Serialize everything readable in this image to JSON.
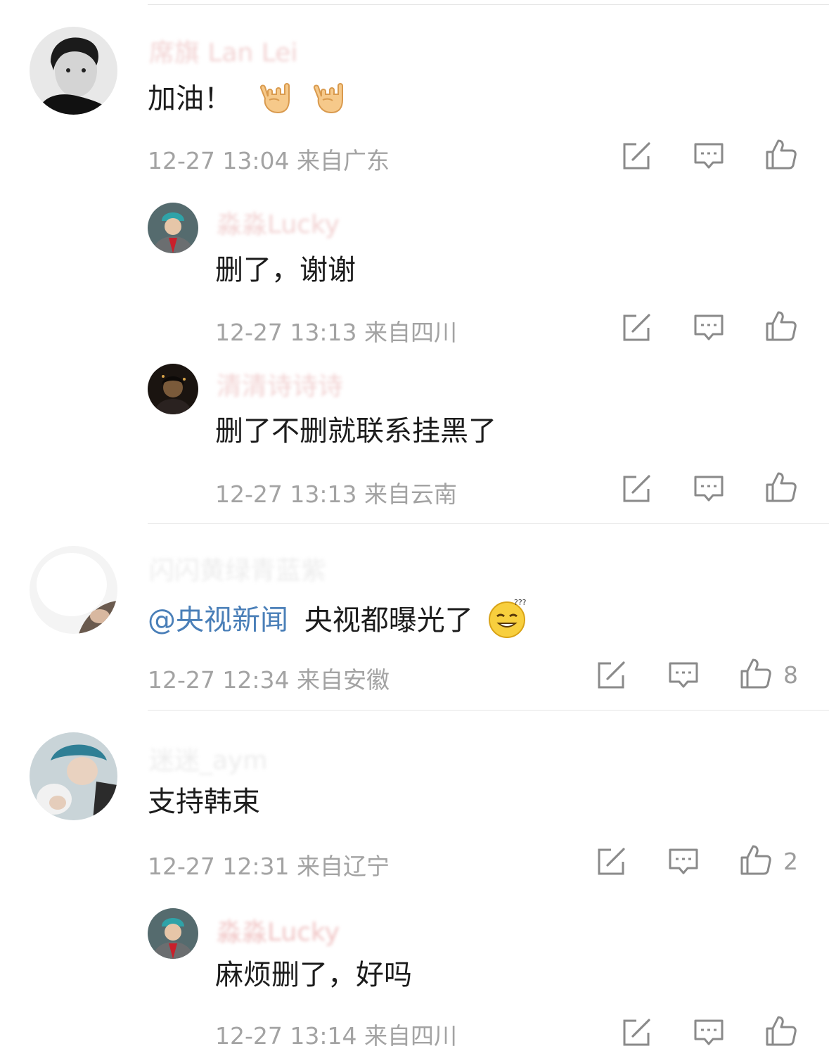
{
  "comments": [
    {
      "name": "席旗 Lan Lei",
      "text": "加油！",
      "meta": "12-27 13:04 来自广东",
      "replies": [
        {
          "name": "淼淼Lucky",
          "text": "删了，谢谢",
          "meta": "12-27 13:13 来自四川"
        },
        {
          "name": "清清诗诗诗",
          "text": "删了不删就联系挂黑了",
          "meta": "12-27 13:13 来自云南"
        }
      ]
    },
    {
      "name": "闪闪黄绿青蓝紫",
      "mention": "@央视新闻",
      "text": "央视都曝光了",
      "meta": "12-27 12:34 来自安徽",
      "likes": "8"
    },
    {
      "name": "迷迷_aym",
      "text": "支持韩束",
      "meta": "12-27 12:31 来自辽宁",
      "likes": "2",
      "replies": [
        {
          "name": "淼淼Lucky",
          "text": "麻烦删了，好吗",
          "meta": "12-27 13:14 来自四川"
        }
      ]
    }
  ],
  "icons": {
    "edit": "edit-icon",
    "reply": "comment-icon",
    "like": "thumbs-up-icon",
    "emoji_rock": "rock-hand-emoji",
    "emoji_dizzy": "dizzy-face-emoji"
  },
  "colors": {
    "mention": "#4a7fb8",
    "meta": "#a3a3a3",
    "text": "#1c1c1c"
  }
}
